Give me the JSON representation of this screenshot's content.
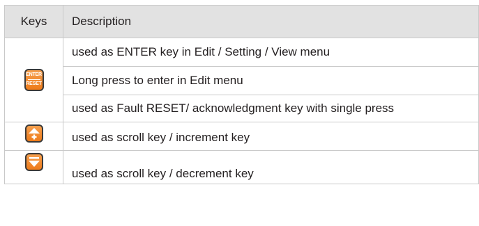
{
  "table": {
    "headers": {
      "keys": "Keys",
      "description": "Description"
    },
    "enter_key": {
      "icon": "enter-reset-key-icon",
      "label_top": "ENTER",
      "label_bottom": "RESET",
      "descriptions": [
        "used as ENTER key in Edit / Setting / View menu",
        "Long press to enter in Edit menu",
        "used as Fault RESET/ acknowledgment key with single press"
      ]
    },
    "up_key": {
      "icon": "up-plus-key-icon",
      "description": "used as scroll key / increment key"
    },
    "down_key": {
      "icon": "down-key-icon",
      "description": "used as scroll key / decrement key"
    }
  },
  "colors": {
    "key_orange": "#f28c28",
    "header_bg": "#e2e2e2",
    "border": "#c9c9c9"
  }
}
